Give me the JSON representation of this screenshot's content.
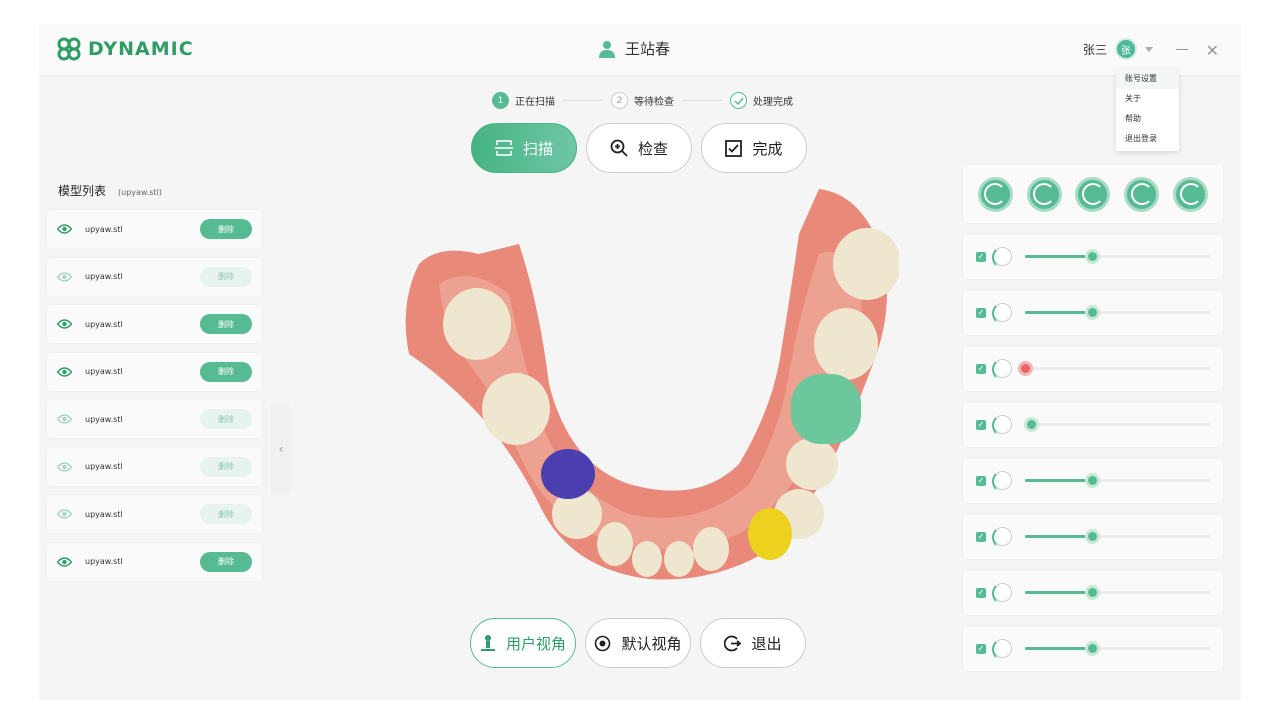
{
  "header": {
    "brand": "DYNAMIC",
    "patient_name": "王站春",
    "user_name": "张三",
    "avatar_initial": "张"
  },
  "user_menu": [
    "账号设置",
    "关于",
    "帮助",
    "退出登录"
  ],
  "steps": [
    {
      "num": "1",
      "label": "正在扫描",
      "state": "active"
    },
    {
      "num": "2",
      "label": "等待检查",
      "state": "idle"
    },
    {
      "num": "",
      "label": "处理完成",
      "state": "done"
    }
  ],
  "modes": [
    {
      "label": "扫描",
      "icon": "scan-icon",
      "active": true
    },
    {
      "label": "检查",
      "icon": "zoom-in-icon",
      "active": false
    },
    {
      "label": "完成",
      "icon": "checkbox-icon",
      "active": false
    }
  ],
  "model_list": {
    "title": "模型列表",
    "file": "(upyaw.stl)",
    "items": [
      {
        "name": "upyaw.stl",
        "delete_label": "删除",
        "visible": true
      },
      {
        "name": "upyaw.stl",
        "delete_label": "删除",
        "visible": false
      },
      {
        "name": "upyaw.stl",
        "delete_label": "删除",
        "visible": true
      },
      {
        "name": "upyaw.stl",
        "delete_label": "删除",
        "visible": true
      },
      {
        "name": "upyaw.stl",
        "delete_label": "删除",
        "visible": false
      },
      {
        "name": "upyaw.stl",
        "delete_label": "删除",
        "visible": false
      },
      {
        "name": "upyaw.stl",
        "delete_label": "删除",
        "visible": false
      },
      {
        "name": "upyaw.stl",
        "delete_label": "删除",
        "visible": true
      }
    ]
  },
  "bottom_actions": [
    {
      "label": "用户视角",
      "icon": "user-view-icon",
      "active": true
    },
    {
      "label": "默认视角",
      "icon": "default-view-icon",
      "active": false
    },
    {
      "label": "退出",
      "icon": "exit-icon",
      "active": false
    }
  ],
  "right_tools": 5,
  "layers": [
    {
      "checked": true,
      "value": 0.36,
      "color": "#56bb93"
    },
    {
      "checked": true,
      "value": 0.36,
      "color": "#56bb93"
    },
    {
      "checked": true,
      "value": 0.0,
      "color": "#e56666"
    },
    {
      "checked": true,
      "value": 0.03,
      "color": "#56bb93"
    },
    {
      "checked": true,
      "value": 0.36,
      "color": "#56bb93"
    },
    {
      "checked": true,
      "value": 0.36,
      "color": "#56bb93"
    },
    {
      "checked": true,
      "value": 0.36,
      "color": "#56bb93"
    },
    {
      "checked": true,
      "value": 0.36,
      "color": "#56bb93"
    }
  ],
  "colors": {
    "accent": "#56bb93",
    "brand": "#2e9d66",
    "marker_blue": "#4b3fb0",
    "marker_green": "#6cc79d",
    "marker_yellow": "#ecd11f"
  }
}
